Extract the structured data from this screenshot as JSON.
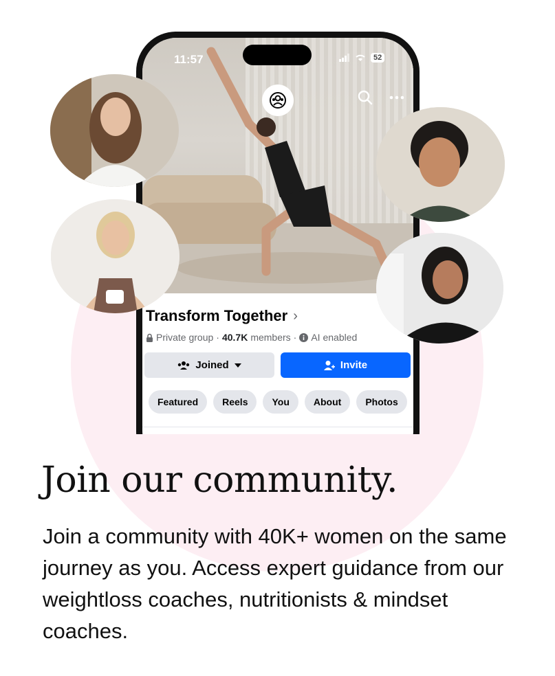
{
  "status_bar": {
    "time": "11:57",
    "battery": "52"
  },
  "group": {
    "title": "Transform Together",
    "privacy": "Private group",
    "dot": "·",
    "member_count": "40.7K",
    "members_label": "members",
    "ai_label": "AI enabled"
  },
  "actions": {
    "joined_label": "Joined",
    "invite_label": "Invite"
  },
  "tabs": [
    "Featured",
    "Reels",
    "You",
    "About",
    "Photos"
  ],
  "marketing": {
    "headline": "Join our community.",
    "body": "Join a community with 40K+ women on the same journey as you. Access expert guidance from our weightloss coaches, nutritionists & mindset coaches."
  },
  "colors": {
    "accent": "#0866ff",
    "pink_background": "#fdeef3",
    "button_gray": "#e4e6eb"
  },
  "icons": [
    "group-icon",
    "search-icon",
    "more-icon",
    "lock-icon",
    "info-icon",
    "members-icon",
    "caret-down-icon",
    "add-person-icon",
    "chevron-right-icon"
  ]
}
